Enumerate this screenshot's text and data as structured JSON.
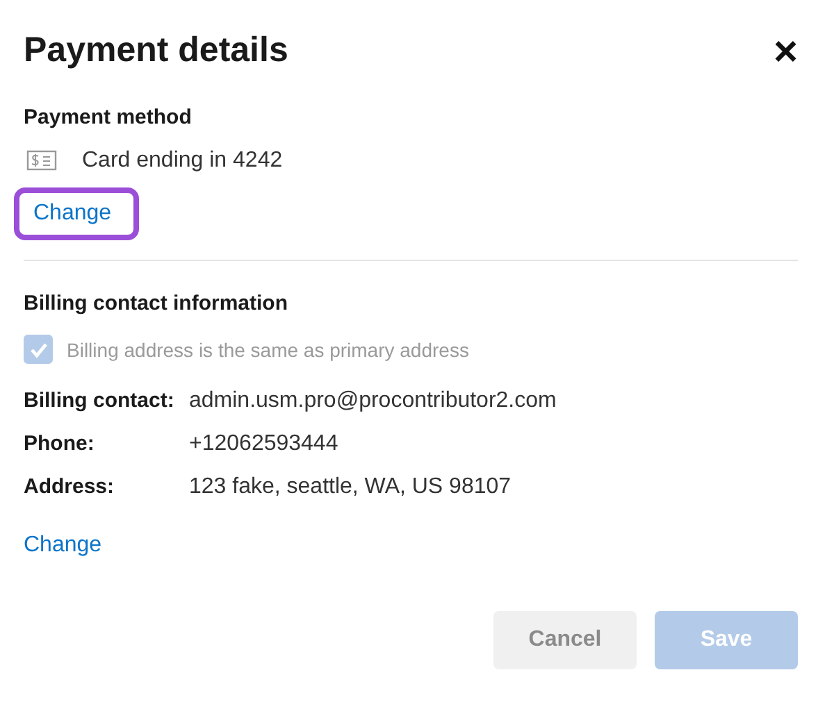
{
  "dialog": {
    "title": "Payment details",
    "close_label": "×"
  },
  "payment_method": {
    "heading": "Payment method",
    "card": "Card ending in 4242",
    "change_link": {
      "label": "Change",
      "focused": true
    }
  },
  "billing": {
    "heading": "Billing contact information",
    "same_address": {
      "label": "Billing address is the same as primary address",
      "checked": true,
      "disabled": true
    },
    "fields": [
      {
        "label": "Billing contact:",
        "value": "admin.usm.pro@procontributor2.com"
      },
      {
        "label": "Phone:",
        "value": "+12062593444"
      },
      {
        "label": "Address:",
        "value": "123 fake, seattle, WA, US 98107"
      }
    ],
    "change_link": {
      "label": "Change",
      "focused": false
    }
  },
  "buttons": [
    {
      "label": "Cancel",
      "kind": "secondary",
      "disabled": true
    },
    {
      "label": "Save",
      "kind": "primary",
      "disabled": true
    }
  ]
}
